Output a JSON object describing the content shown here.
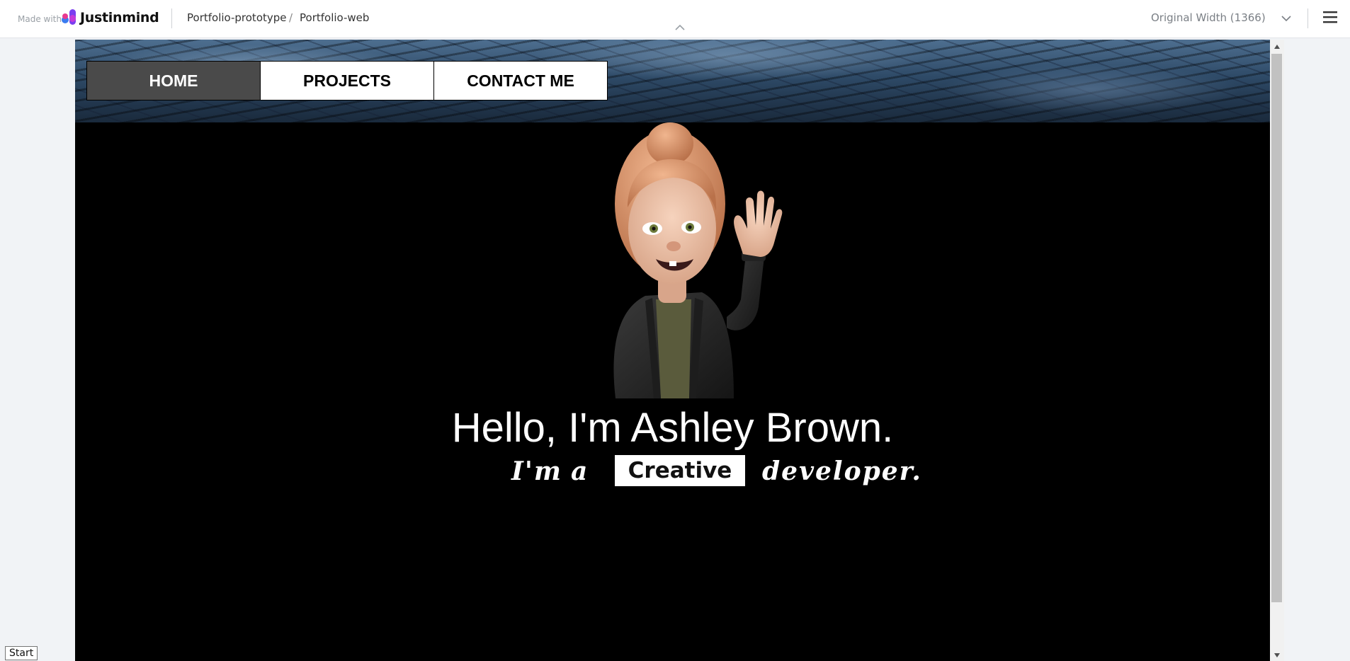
{
  "topbar": {
    "made_with": "Made with",
    "brand": "Justinmind",
    "breadcrumb": {
      "project": "Portfolio-prototype",
      "separator": "/",
      "page": "Portfolio-web"
    },
    "width_select": "Original Width (1366)"
  },
  "nav": {
    "items": [
      {
        "label": "HOME",
        "active": true
      },
      {
        "label": "PROJECTS",
        "active": false
      },
      {
        "label": "CONTACT ME",
        "active": false
      }
    ]
  },
  "hero": {
    "headline": "Hello, I'm Ashley Brown.",
    "subline_prefix_1": "I'm",
    "subline_prefix_2": "a",
    "highlight_word": "Creative",
    "subline_suffix": "developer."
  },
  "footer": {
    "start_button": "Start"
  },
  "colors": {
    "canvas_bg": "#000000",
    "nav_active_bg": "#4a4a4a",
    "nav_bg": "#ffffff",
    "accent_logo_pink": "#e8398f",
    "accent_logo_purple": "#7a3ff0"
  }
}
